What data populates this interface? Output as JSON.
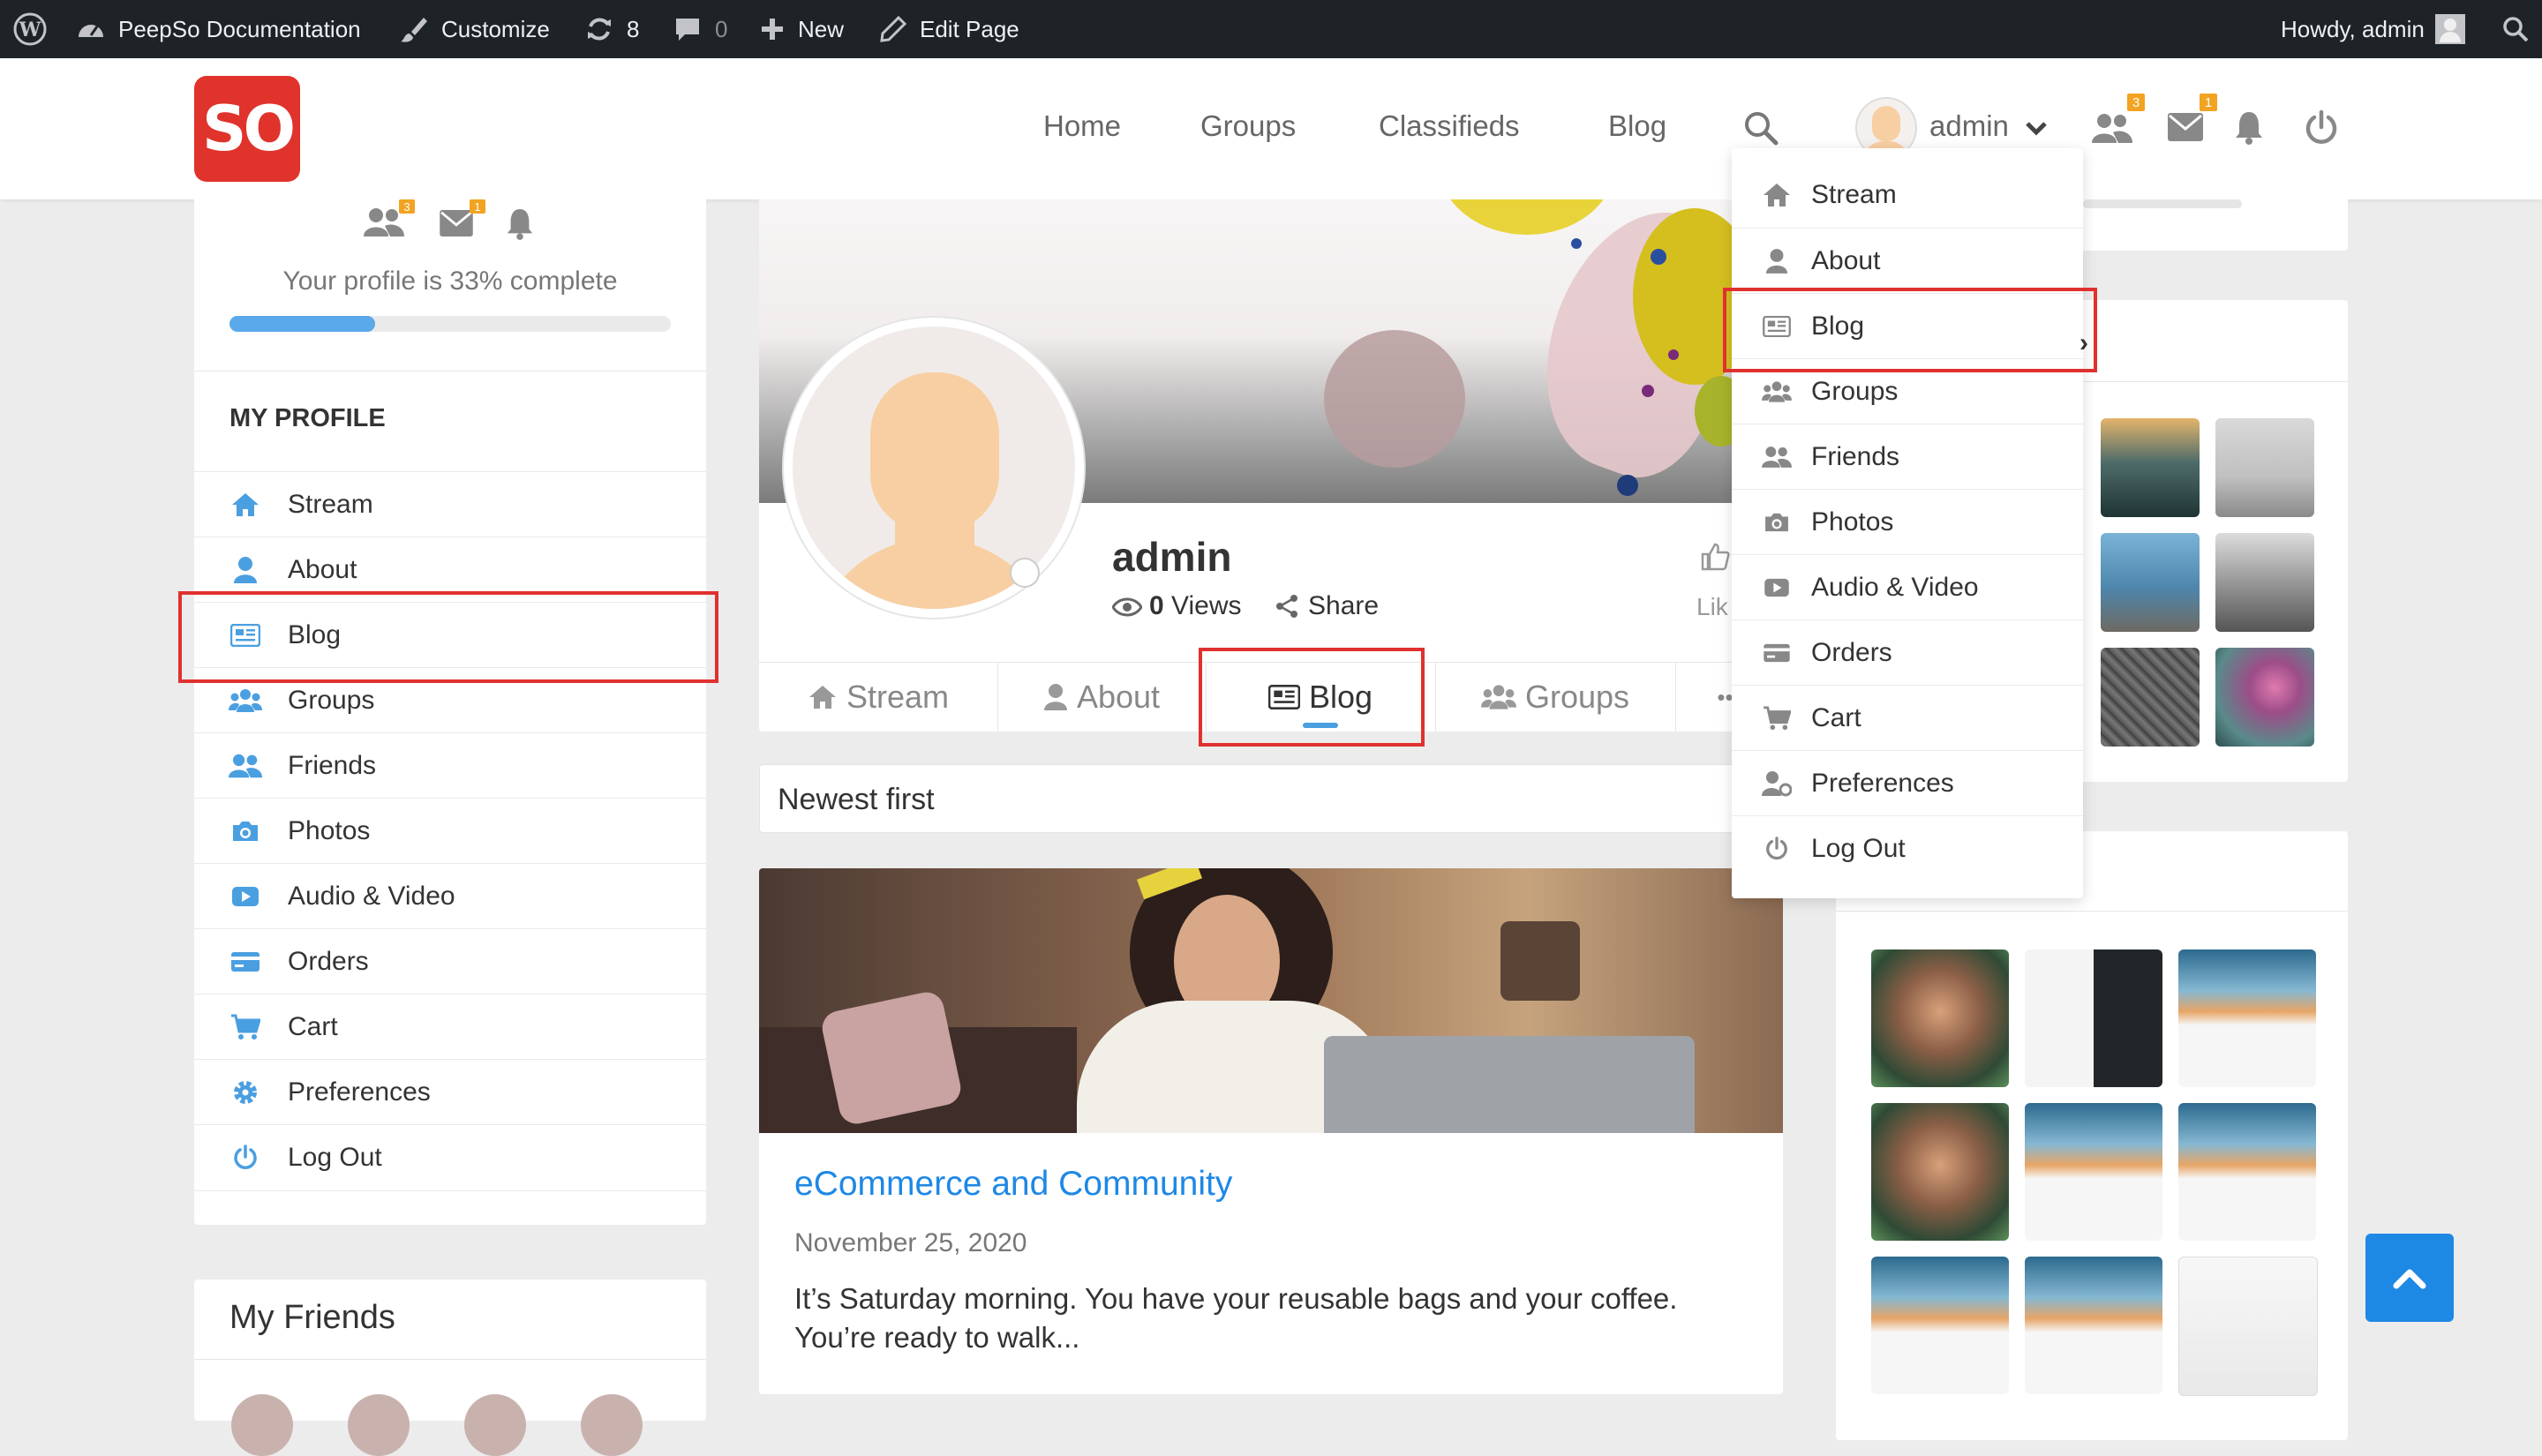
{
  "admin_bar": {
    "site_name": "PeepSo Documentation",
    "customize": "Customize",
    "updates_count": "8",
    "comments_count": "0",
    "new_label": "New",
    "edit_page": "Edit Page",
    "howdy": "Howdy, admin"
  },
  "header": {
    "logo_text": "SO",
    "nav": [
      "Home",
      "Groups",
      "Classifieds",
      "Blog"
    ],
    "user_name": "admin",
    "friends_badge": "3",
    "messages_badge": "1"
  },
  "user_dropdown": {
    "items": [
      "Stream",
      "About",
      "Blog",
      "Groups",
      "Friends",
      "Photos",
      "Audio & Video",
      "Orders",
      "Cart",
      "Preferences",
      "Log Out"
    ],
    "highlighted": "Blog"
  },
  "sidebar": {
    "badges": {
      "friends": "3",
      "messages": "1"
    },
    "profile_completion_text": "Your profile is 33% complete",
    "profile_completion": 0.33,
    "my_profile_title": "MY PROFILE",
    "items": [
      "Stream",
      "About",
      "Blog",
      "Groups",
      "Friends",
      "Photos",
      "Audio & Video",
      "Orders",
      "Cart",
      "Preferences",
      "Log Out"
    ],
    "highlighted": "Blog",
    "my_friends_title": "My Friends"
  },
  "profile": {
    "name": "admin",
    "views_count": "0",
    "views_label": "Views",
    "share_label": "Share",
    "like_label": "Lik",
    "tabs": [
      "Stream",
      "About",
      "Blog",
      "Groups"
    ],
    "active_tab": "Blog",
    "more": "•••"
  },
  "sort": {
    "label": "Newest first"
  },
  "post": {
    "title": "eCommerce and Community",
    "date": "November 25, 2020",
    "excerpt": "It’s Saturday morning. You have your reusable bags and your coffee. You’re ready to walk..."
  },
  "colors": {
    "accent": "#1e88e5",
    "logo_red": "#e0332c",
    "highlight_red": "#e0312f",
    "badge_orange": "#f2a321",
    "sidebar_icon": "#4a9fe0"
  }
}
